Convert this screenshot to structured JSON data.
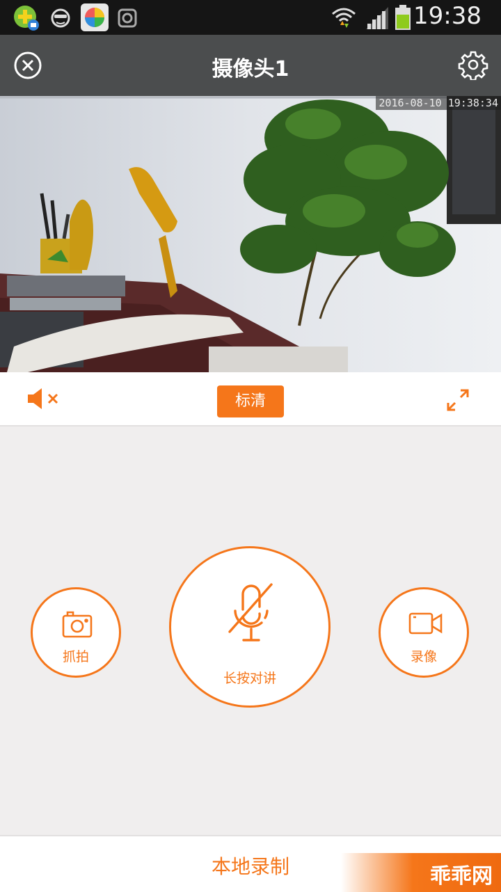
{
  "status_bar": {
    "time": "19:38",
    "icons": [
      "app-badge-icon",
      "face-icon",
      "app-store-icon",
      "camera-app-icon",
      "wifi-icon",
      "signal-icon",
      "battery-icon"
    ]
  },
  "header": {
    "title": "摄像头1",
    "close_icon": "close-icon",
    "settings_icon": "gear-icon"
  },
  "video": {
    "timestamp": "2016-08-10 19:38:34"
  },
  "controls": {
    "mute_icon": "speaker-muted-icon",
    "quality_label": "标清",
    "fullscreen_icon": "expand-icon"
  },
  "actions": {
    "snapshot_label": "抓拍",
    "talk_label": "长按对讲",
    "record_label": "录像"
  },
  "footer": {
    "local_record_label": "本地录制",
    "watermark": "乖乖网"
  },
  "colors": {
    "accent": "#f5761a",
    "titlebar": "#4b4d4e",
    "statusbar": "#151515",
    "background": "#f0eeee"
  }
}
